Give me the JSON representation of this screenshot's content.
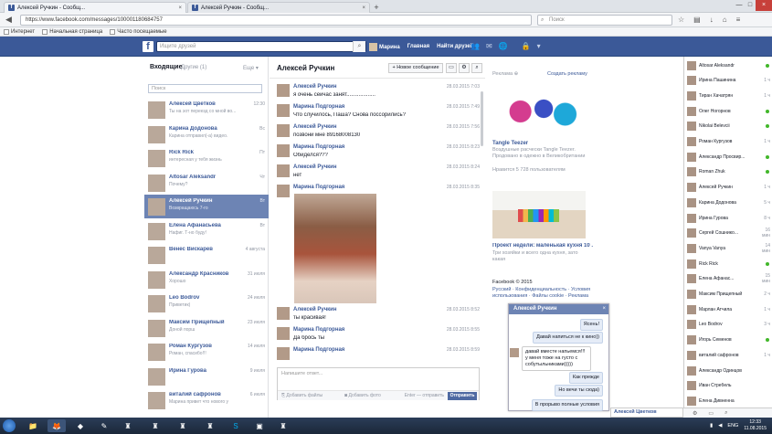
{
  "browser": {
    "tabs": [
      {
        "title": "Алексей Ручкин - Сообщ..."
      },
      {
        "title": "Алексей Ручкин - Сообщ..."
      }
    ],
    "new_tab": "+",
    "url": "https://www.facebook.com/messages/100001180684757",
    "search_placeholder": "Поиск",
    "bookmarks": [
      "Интернет",
      "Начальная страница",
      "Часто посещаемые"
    ]
  },
  "fb": {
    "logo": "f",
    "search_placeholder": "Ищите друзей",
    "nav": [
      "Марина",
      "Главная",
      "Найти друзей"
    ]
  },
  "inbox": {
    "header": "Входящие",
    "other": "Другие (1)",
    "more": "Еще ▾",
    "search_placeholder": "Поиск",
    "threads": [
      {
        "name": "Алексей Цветков",
        "snippet": "Ты на эот переезд со мной во...",
        "time": "12:30"
      },
      {
        "name": "Карина Додонова",
        "snippet": "Карина отправил(-а) видео.",
        "time": "Вс"
      },
      {
        "name": "Rick Rick",
        "snippet": "интересная у тебя жизнь",
        "time": "Пт"
      },
      {
        "name": "Altosar Aleksandr",
        "snippet": "Почему?",
        "time": "Чт"
      },
      {
        "name": "Алексей Ручкин",
        "snippet": "Возвращаюсь 7-го",
        "time": "Вт"
      },
      {
        "name": "Елена Афанасьева",
        "snippet": "Нафиг. Т-но буду!",
        "time": "Вт"
      },
      {
        "name": "Венес Вискарев",
        "snippet": "",
        "time": "4 августа"
      },
      {
        "name": "Александр Красников",
        "snippet": "Хорошо",
        "time": "31 июля"
      },
      {
        "name": "Leo Bodrov",
        "snippet": "Приветик)",
        "time": "24 июля"
      },
      {
        "name": "Максим Прищепный",
        "snippet": "Доной порш",
        "time": "23 июля"
      },
      {
        "name": "Роман Кургузов",
        "snippet": "Роман, спасибо!!!",
        "time": "14 июля"
      },
      {
        "name": "Ирина Гурова",
        "snippet": "",
        "time": "9 июля"
      },
      {
        "name": "виталий сафронов",
        "snippet": "Марина привет что нового у",
        "time": "6 июля"
      }
    ]
  },
  "conversation": {
    "title": "Алексей Ручкин",
    "new_message": "+ Новое сообщение",
    "messages": [
      {
        "name": "Алексей Ручкин",
        "text": "я очень сейчас занят...................",
        "time": "28.03.2015 7:03"
      },
      {
        "name": "Марина Подгорная",
        "text": "Что случилось, Паша? Снова поссорились?",
        "time": "28.03.2015 7:49"
      },
      {
        "name": "Алексей Ручкин",
        "text": "позвони мне 89168008130",
        "time": "28.03.2015 7:56"
      },
      {
        "name": "Марина Подгорная",
        "text": "Обиделся???",
        "time": "28.03.2015 8:23"
      },
      {
        "name": "Алексей Ручкин",
        "text": "нет",
        "time": "28.03.2015 8:24"
      },
      {
        "name": "Марина Подгорная",
        "text": "",
        "time": "28.03.2015 8:35"
      },
      {
        "name": "Алексей Ручкин",
        "text": "ты красивая!",
        "time": "28.03.2015 8:52"
      },
      {
        "name": "Марина Подгорная",
        "text": "Да брось ты",
        "time": "28.03.2015 8:55"
      },
      {
        "name": "Марина Подгорная",
        "text": "",
        "time": "28.03.2015 8:59"
      }
    ],
    "compose_placeholder": "Напишите ответ...",
    "attach_files": "Добавить файлы",
    "attach_photo": "Добавить фото",
    "enter_to_send": "Enter — отправить",
    "send": "Отправить"
  },
  "ads": {
    "header": "Реклама",
    "create": "Создать рекламу",
    "ad1_title": "Tangle Teezer",
    "ad1_text": "Воздушные расчески Tangle Teezer. Продовано в одежно в Великобритании",
    "ad1_likes": "Нравится 5 728 пользователям",
    "ad2_title": "Проект недели: маленькая кухня 10 ...",
    "ad2_text": "Три хозяйки и всего одна кухня, зато какая",
    "footer_copy": "Facebook © 2015",
    "footer_links": "Русский · Конфиденциальность · Условия использования · Файлы cookie · Реклама"
  },
  "chat_popup": {
    "title": "Алексей Ручкин",
    "close": "×",
    "messages": [
      {
        "who": "me",
        "text": "Ясень!"
      },
      {
        "who": "me",
        "text": "Давай напиться не к кино))"
      },
      {
        "who": "them",
        "text": "давай вместе напьемся!!! у меня тоже на густо с собутыльниками)))))"
      },
      {
        "who": "me",
        "text": "Как прежде"
      },
      {
        "who": "me",
        "text": "Но вечи ты сюда)"
      },
      {
        "who": "me",
        "text": "В прорыво полные условия"
      }
    ]
  },
  "chat_sidebar": {
    "friends": [
      {
        "name": "Altosar Aleksandr",
        "status": "online"
      },
      {
        "name": "Ирина Пашинина",
        "status": "1 ч"
      },
      {
        "name": "Тиран Хачатрян",
        "status": "1 ч"
      },
      {
        "name": "Олег Ногорнов",
        "status": "online"
      },
      {
        "name": "Nikolai Belevcii",
        "status": "online"
      },
      {
        "name": "Роман Кургузов",
        "status": "1 ч"
      },
      {
        "name": "Александр Просвир...",
        "status": "online"
      },
      {
        "name": "Roman Zhuk",
        "status": "online"
      },
      {
        "name": "Алексей Ручкин",
        "status": "1 ч"
      },
      {
        "name": "Карина Додонова",
        "status": "5 ч"
      },
      {
        "name": "Ирина Гурова",
        "status": "8 ч"
      },
      {
        "name": "Сергей Сошнико...",
        "status": "16 мин"
      },
      {
        "name": "Vanya Vanya",
        "status": "14 мин"
      },
      {
        "name": "Rick Rick",
        "status": "online"
      },
      {
        "name": "Елена Афанас...",
        "status": "15 мин"
      },
      {
        "name": "Максим Прищепный",
        "status": "2 ч"
      },
      {
        "name": "Марлан Атчила",
        "status": "1 ч"
      },
      {
        "name": "Leo Bodrov",
        "status": "3 ч"
      },
      {
        "name": "Игорь Семенов",
        "status": "online"
      },
      {
        "name": "виталий сафронов",
        "status": "1 ч"
      },
      {
        "name": "Александр Одинцов",
        "status": ""
      },
      {
        "name": "Иван Стребель",
        "status": ""
      },
      {
        "name": "Елена Дивненна",
        "status": ""
      }
    ],
    "search_label": "Алексей Цветков"
  },
  "taskbar": {
    "lang": "ENG",
    "time": "12:33",
    "date": "11.08.2015"
  }
}
